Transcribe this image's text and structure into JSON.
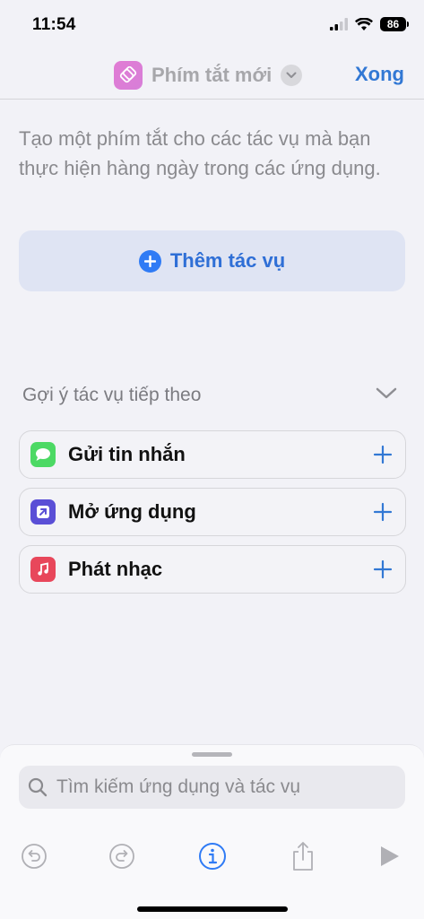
{
  "status": {
    "time": "11:54",
    "battery": "86"
  },
  "nav": {
    "title": "Phím tắt mới",
    "done_label": "Xong"
  },
  "description": "Tạo một phím tắt cho các tác vụ mà bạn thực hiện hàng ngày trong các ứng dụng.",
  "add_action_label": "Thêm tác vụ",
  "suggestions": {
    "header": "Gợi ý tác vụ tiếp theo",
    "items": [
      {
        "label": "Gửi tin nhắn",
        "icon": "messages-icon",
        "color": "#4cd964"
      },
      {
        "label": "Mở ứng dụng",
        "icon": "open-app-icon",
        "color": "#5a4fd6"
      },
      {
        "label": "Phát nhạc",
        "icon": "music-icon",
        "color": "#e8475b"
      }
    ]
  },
  "search": {
    "placeholder": "Tìm kiếm ứng dụng và tác vụ"
  },
  "colors": {
    "accent": "#3278d4",
    "background": "#f2f2f7"
  }
}
